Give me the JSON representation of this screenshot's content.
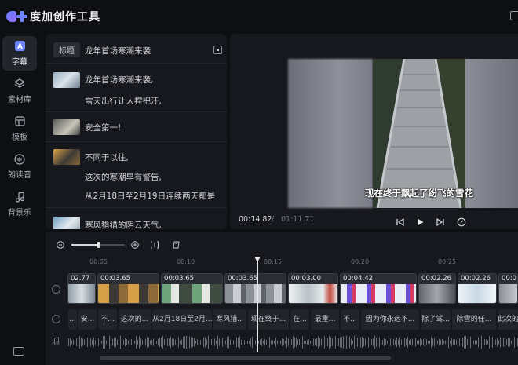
{
  "app": {
    "title": "度加创作工具"
  },
  "sidebar": {
    "items": [
      {
        "label": "字幕",
        "icon": "subtitle-icon",
        "active": true
      },
      {
        "label": "素材库",
        "icon": "layers-icon",
        "active": false
      },
      {
        "label": "模板",
        "icon": "template-icon",
        "active": false
      },
      {
        "label": "朗读音",
        "icon": "voice-icon",
        "active": false
      },
      {
        "label": "背景乐",
        "icon": "music-note-icon",
        "active": false
      }
    ]
  },
  "script_panel": {
    "title_tag": "标题",
    "title_text": "龙年首场寒潮来袭",
    "blocks": [
      {
        "lines": [
          "龙年首场寒潮来袭,",
          "雪天出行让人捏把汗,"
        ]
      },
      {
        "lines": [
          "安全第一!"
        ]
      },
      {
        "lines": [
          "不同于以往,",
          "这次的寒潮早有警告,",
          "从2月18日至2月19日连续两天都是"
        ]
      },
      {
        "lines": [
          "寒风猎猎的阴云天气,"
        ]
      }
    ]
  },
  "preview": {
    "caption": "现在终于飘起了纷飞的雪花",
    "current_time": "00:14.82",
    "separator": "/",
    "total_time": "01:11.71"
  },
  "timeline": {
    "ruler_labels": [
      "00:05",
      "00:10",
      "00:15",
      "00:20",
      "00:25"
    ],
    "clips": [
      "02.77",
      "00:03.65",
      "00:03.65",
      "00:03.65",
      "00:03.00",
      "00:04.42",
      "00:02.26",
      "00:02.26",
      "00:0"
    ],
    "subtitles": [
      "...",
      "安...",
      "不...",
      "这次的...",
      "从2月18日至2月...",
      "寒风猎...",
      "现在终于...",
      "在...",
      "最重...",
      "不...",
      "因为你永远不...",
      "除了驾...",
      "除雪的任...",
      "此次的"
    ]
  },
  "colors": {
    "accent": "#6e86ff",
    "panel": "#17181d",
    "background": "#0e0f13"
  }
}
